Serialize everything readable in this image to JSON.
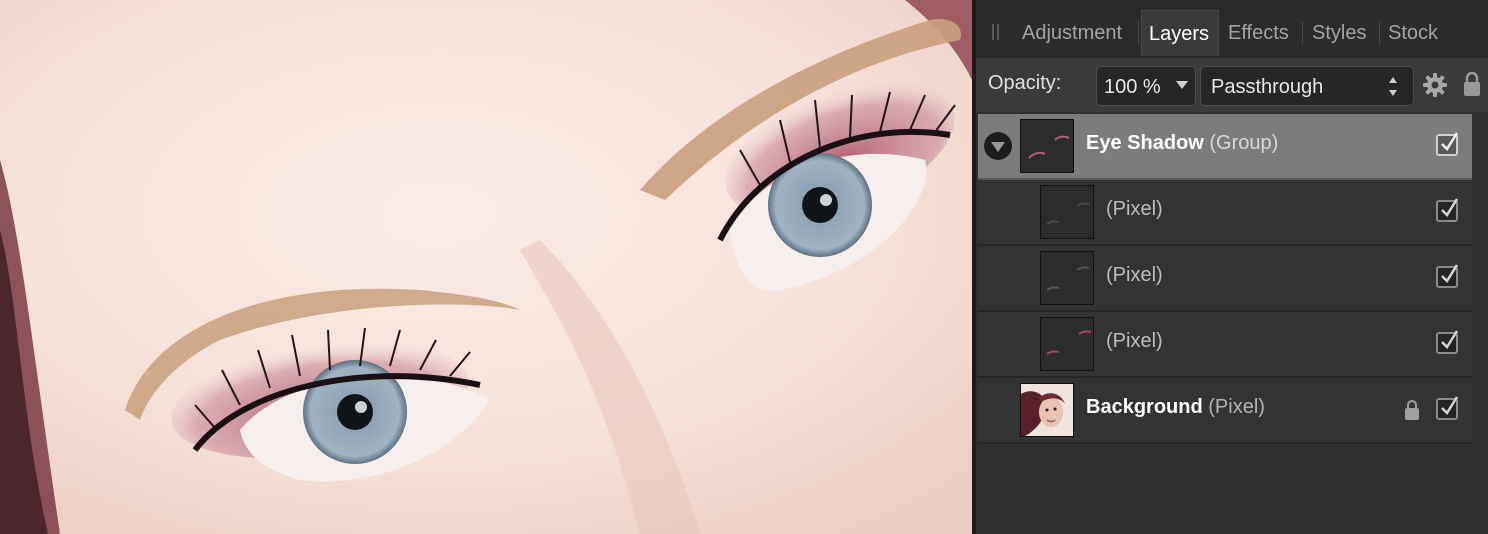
{
  "panel": {
    "tabs": [
      {
        "label": "Adjustment",
        "active": false
      },
      {
        "label": "Layers",
        "active": true
      },
      {
        "label": "Effects",
        "active": false
      },
      {
        "label": "Styles",
        "active": false
      },
      {
        "label": "Stock",
        "active": false
      }
    ],
    "options": {
      "opacity_label": "Opacity:",
      "opacity_value": "100 %",
      "blend_mode": "Passthrough",
      "settings_icon": "gear-icon",
      "lock_icon": "lock-icon"
    },
    "layers": [
      {
        "name": "Eye Shadow",
        "type": "(Group)",
        "selected": true,
        "expanded": true,
        "visible": true,
        "locked": false,
        "indent": 0
      },
      {
        "name": "",
        "type": "(Pixel)",
        "selected": false,
        "visible": true,
        "locked": false,
        "indent": 1
      },
      {
        "name": "",
        "type": "(Pixel)",
        "selected": false,
        "visible": true,
        "locked": false,
        "indent": 1
      },
      {
        "name": "",
        "type": "(Pixel)",
        "selected": false,
        "visible": true,
        "locked": false,
        "indent": 1
      },
      {
        "name": "Background",
        "type": "(Pixel)",
        "selected": false,
        "visible": true,
        "locked": true,
        "indent": 0
      }
    ]
  },
  "colors": {
    "panel_bg": "#323232",
    "selected_row": "#7c7c7c",
    "eyeshadow": "#a8485e",
    "iris": "#8fa6b8"
  }
}
